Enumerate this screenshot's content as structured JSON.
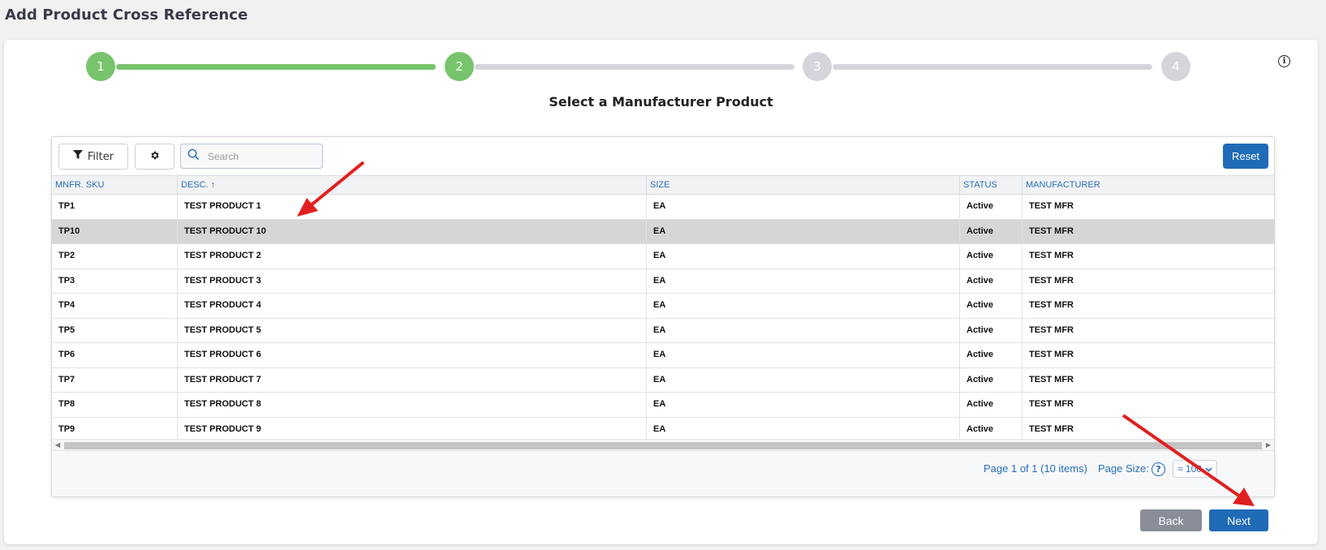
{
  "page": {
    "title": "Add Product Cross Reference"
  },
  "stepper": {
    "steps": [
      {
        "label": "1",
        "state": "done"
      },
      {
        "label": "2",
        "state": "done"
      },
      {
        "label": "3",
        "state": "todo"
      },
      {
        "label": "4",
        "state": "todo"
      }
    ],
    "title": "Select a Manufacturer Product",
    "colors": {
      "done": "#77c46c",
      "todo": "#d4d6dc"
    }
  },
  "grid": {
    "toolbar": {
      "filter_label": "Filter",
      "search_placeholder": "Search",
      "reset_label": "Reset"
    },
    "columns": [
      "MNFR. SKU",
      "DESC. ↑",
      "SIZE",
      "STATUS",
      "MANUFACTURER"
    ],
    "rows": [
      {
        "sku": "TP1",
        "desc": "TEST PRODUCT 1",
        "size": "EA",
        "status": "Active",
        "manufacturer": "TEST MFR"
      },
      {
        "sku": "TP10",
        "desc": "TEST PRODUCT 10",
        "size": "EA",
        "status": "Active",
        "manufacturer": "TEST MFR"
      },
      {
        "sku": "TP2",
        "desc": "TEST PRODUCT 2",
        "size": "EA",
        "status": "Active",
        "manufacturer": "TEST MFR"
      },
      {
        "sku": "TP3",
        "desc": "TEST PRODUCT 3",
        "size": "EA",
        "status": "Active",
        "manufacturer": "TEST MFR"
      },
      {
        "sku": "TP4",
        "desc": "TEST PRODUCT 4",
        "size": "EA",
        "status": "Active",
        "manufacturer": "TEST MFR"
      },
      {
        "sku": "TP5",
        "desc": "TEST PRODUCT 5",
        "size": "EA",
        "status": "Active",
        "manufacturer": "TEST MFR"
      },
      {
        "sku": "TP6",
        "desc": "TEST PRODUCT 6",
        "size": "EA",
        "status": "Active",
        "manufacturer": "TEST MFR"
      },
      {
        "sku": "TP7",
        "desc": "TEST PRODUCT 7",
        "size": "EA",
        "status": "Active",
        "manufacturer": "TEST MFR"
      },
      {
        "sku": "TP8",
        "desc": "TEST PRODUCT 8",
        "size": "EA",
        "status": "Active",
        "manufacturer": "TEST MFR"
      },
      {
        "sku": "TP9",
        "desc": "TEST PRODUCT 9",
        "size": "EA",
        "status": "Active",
        "manufacturer": "TEST MFR"
      }
    ],
    "selected_row_sku": "TP10",
    "footer": {
      "page_info": "Page 1 of 1 (10 items)",
      "page_size_label": "Page Size:",
      "page_size_value": "≈ 100"
    }
  },
  "actions": {
    "back_label": "Back",
    "next_label": "Next"
  },
  "annotations": {
    "arrow_color": "#e02020"
  }
}
